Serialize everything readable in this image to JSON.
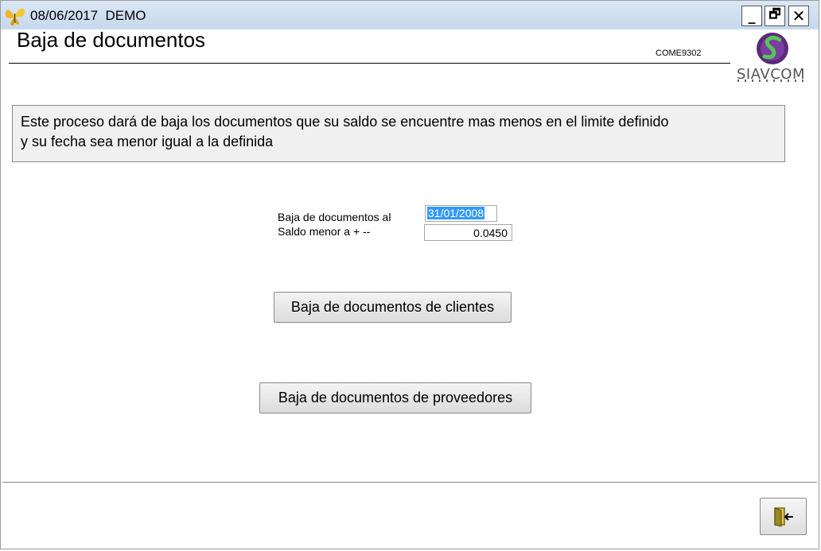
{
  "window": {
    "title": "08/06/2017  DEMO",
    "icons": {
      "app": "butterfly-icon",
      "minimize": "minimize-icon",
      "restore": "restore-icon",
      "close": "close-icon"
    },
    "controls": {
      "minimize": "_",
      "restore": "🗗",
      "close": "✕"
    }
  },
  "form": {
    "title": "Baja de documentos",
    "code": "COME9302",
    "logo_text": "SIAVCOM"
  },
  "info": {
    "line1": "Este proceso dará de baja los documentos que su saldo se encuentre mas menos en el limite definido",
    "line2": "y su fecha sea menor igual a la definida"
  },
  "fields": {
    "date_label": "Baja de documentos al",
    "date_value": "31/01/2008",
    "saldo_label": "Saldo  menor a + --",
    "saldo_value": "0.0450"
  },
  "buttons": {
    "clientes": "Baja de documentos de clientes",
    "proveedores": "Baja de documentos de proveedores",
    "exit_icon": "exit-door-icon"
  },
  "colors": {
    "titlebar": "#c7d9ee",
    "selection": "#3399ff",
    "logo_green": "#4ab04a",
    "logo_purple": "#6a2c8a"
  }
}
